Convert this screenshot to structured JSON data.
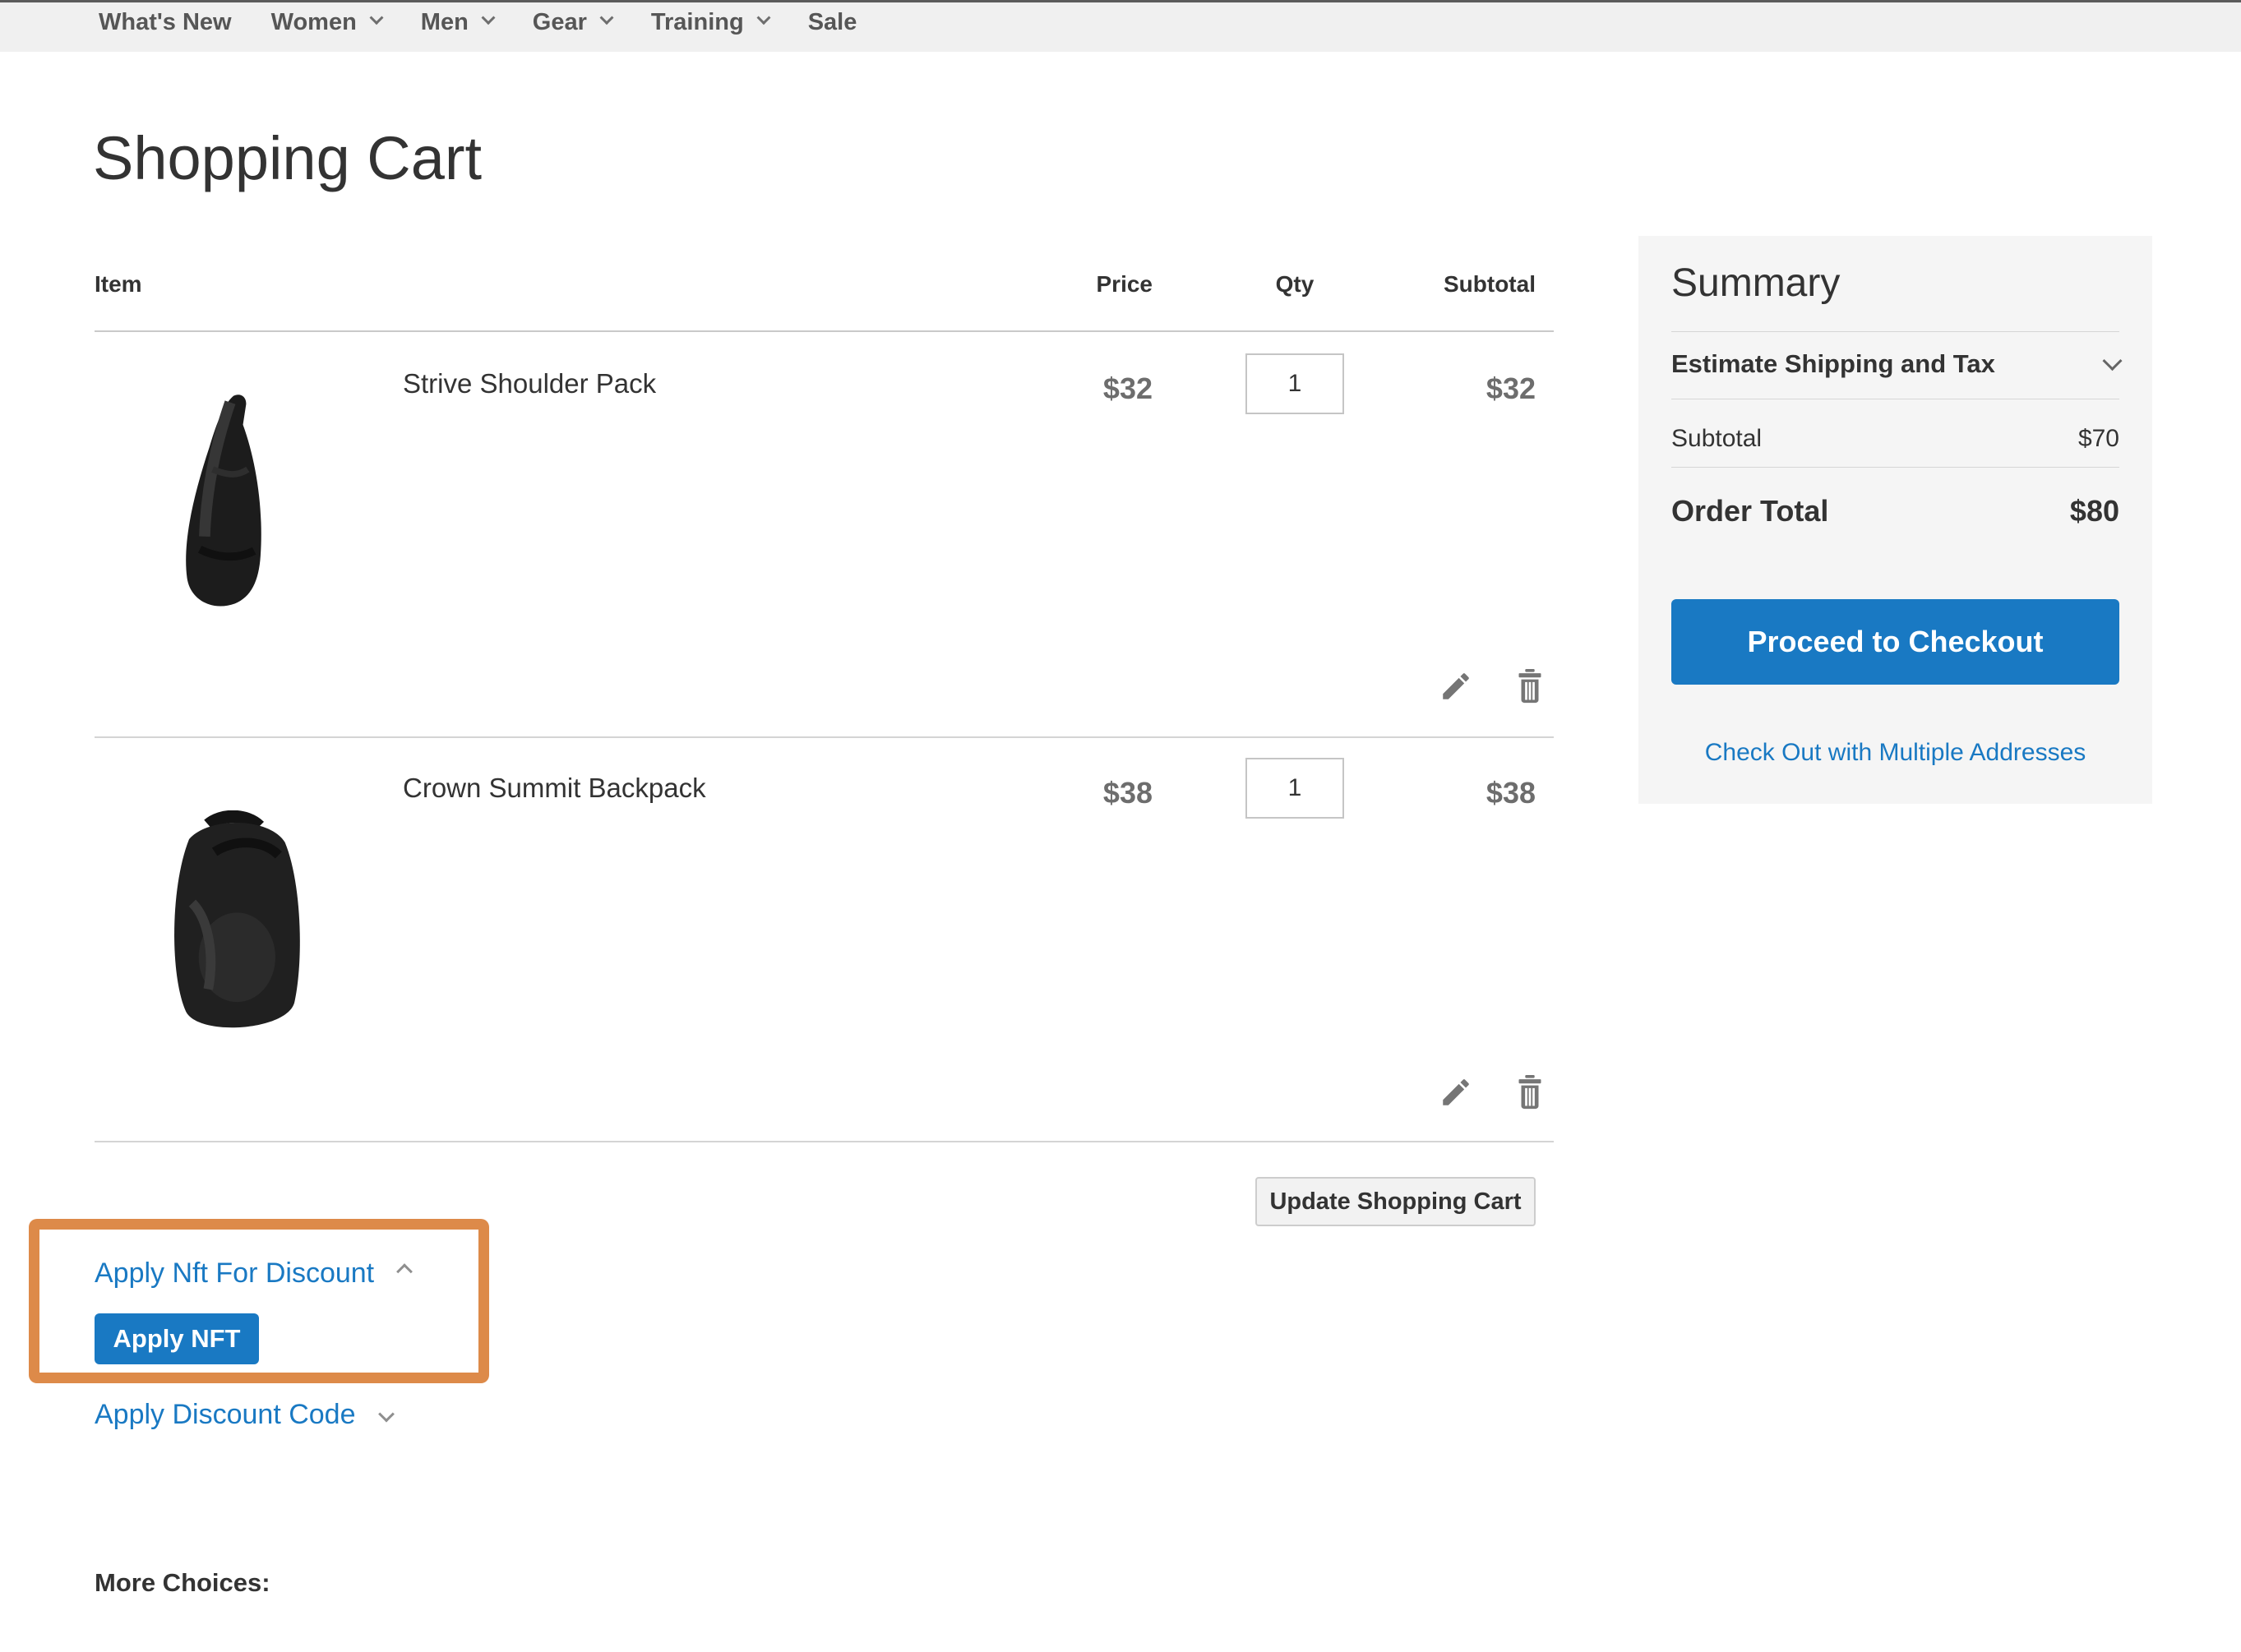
{
  "nav": {
    "items": [
      {
        "label": "What's New",
        "dropdown": false
      },
      {
        "label": "Women",
        "dropdown": true
      },
      {
        "label": "Men",
        "dropdown": true
      },
      {
        "label": "Gear",
        "dropdown": true
      },
      {
        "label": "Training",
        "dropdown": true
      },
      {
        "label": "Sale",
        "dropdown": false
      }
    ]
  },
  "page": {
    "title": "Shopping Cart"
  },
  "cart": {
    "headers": {
      "item": "Item",
      "price": "Price",
      "qty": "Qty",
      "subtotal": "Subtotal"
    },
    "items": [
      {
        "name": "Strive Shoulder Pack",
        "price": "$32",
        "qty": "1",
        "subtotal": "$32",
        "image": "black-sling-shoulder-pack"
      },
      {
        "name": "Crown Summit Backpack",
        "price": "$38",
        "qty": "1",
        "subtotal": "$38",
        "image": "black-backpack"
      }
    ],
    "update_button_label": "Update Shopping Cart"
  },
  "discount": {
    "nft_toggle_label": "Apply Nft For Discount",
    "nft_button_label": "Apply NFT",
    "code_toggle_label": "Apply Discount Code"
  },
  "summary": {
    "title": "Summary",
    "estimate_label": "Estimate Shipping and Tax",
    "subtotal_label": "Subtotal",
    "subtotal_value": "$70",
    "order_total_label": "Order Total",
    "order_total_value": "$80",
    "checkout_button_label": "Proceed to Checkout",
    "multi_address_link_label": "Check Out with Multiple Addresses"
  },
  "more_choices_label": "More Choices:",
  "colors": {
    "accent_blue": "#1979c3",
    "annotation_orange": "#dd8a49",
    "nav_bg": "#f0f0f0",
    "summary_bg": "#f5f5f5",
    "price_gray": "#6d6d6d"
  }
}
